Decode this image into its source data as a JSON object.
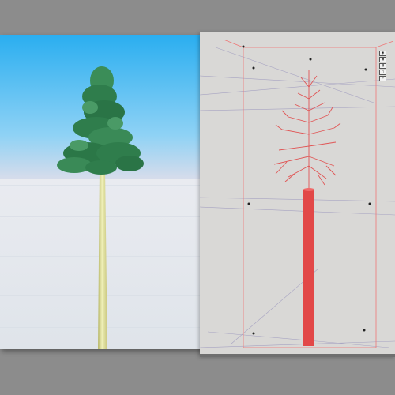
{
  "app": {
    "panels": [
      {
        "id": "render",
        "kind": "rendered-preview",
        "subject": "pine-tree"
      },
      {
        "id": "wireframe",
        "kind": "wireframe-view",
        "subject": "pine-tree-skeleton"
      }
    ]
  },
  "toolbar": {
    "buttons": [
      {
        "name": "view-mode-1-button",
        "icon": "camera-icon",
        "label": ""
      },
      {
        "name": "view-mode-2-button",
        "icon": "grid-icon",
        "label": ""
      },
      {
        "name": "view-mode-3-button",
        "icon": "mesh-icon",
        "label": ""
      },
      {
        "name": "view-mode-4-button",
        "icon": "frame-icon",
        "label": ""
      },
      {
        "name": "view-mode-5-button",
        "icon": "light-icon",
        "label": ""
      }
    ]
  },
  "colors": {
    "sky_top": "#2aaef0",
    "sky_bottom": "#c9e8f6",
    "snow": "#eef2f6",
    "foliage": "#2e7a4a",
    "trunk": "#d8d89a",
    "wire_accent": "#e84848",
    "wire_guides": "#9b97b8",
    "paper": "#d9d8d6"
  }
}
